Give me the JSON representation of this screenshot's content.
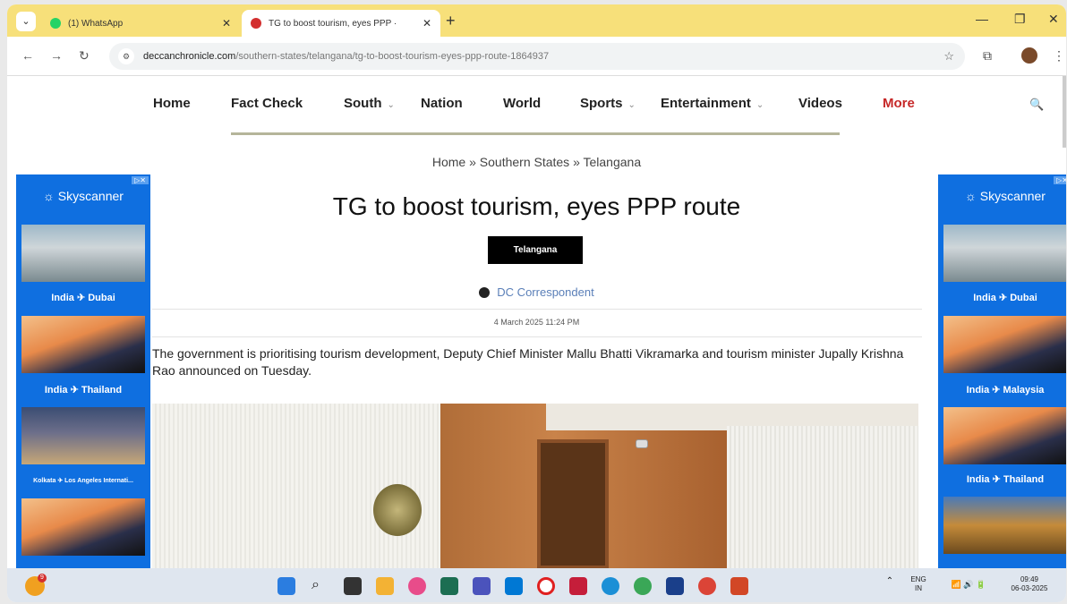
{
  "browser": {
    "tabs": [
      {
        "title": "(1) WhatsApp",
        "favicon_color": "#25d366"
      },
      {
        "title": "TG to boost tourism, eyes PPP · ",
        "favicon_color": "#d32f2f"
      }
    ],
    "url_domain": "deccanchronicle.com",
    "url_path": "/southern-states/telangana/tg-to-boost-tourism-eyes-ppp-route-1864937"
  },
  "site_nav": {
    "items": [
      "Home",
      "Fact Check",
      "South",
      "Nation",
      "World",
      "Sports",
      "Entertainment",
      "Videos",
      "More"
    ],
    "accent": "#c62828"
  },
  "article": {
    "breadcrumb": "Home » Southern States » Telangana",
    "headline": "TG to boost tourism, eyes PPP route",
    "category": "Telangana",
    "author": "DC Correspondent",
    "date": "4 March 2025 11:24 PM",
    "lead": "The government is prioritising tourism development, Deputy Chief Minister Mallu Bhatti Vikramarka and tourism minister Jupally Krishna Rao announced on Tuesday."
  },
  "ads": {
    "left": {
      "brand": "Skyscanner",
      "routes": [
        "India ✈ Dubai",
        "India ✈ Thailand",
        "Kolkata ✈ Los Angeles Internati..."
      ]
    },
    "right": {
      "brand": "Skyscanner",
      "routes": [
        "India ✈ Dubai",
        "India ✈ Malaysia",
        "India ✈ Thailand"
      ]
    },
    "color": "#0f6fe0"
  },
  "taskbar": {
    "weather_badge": "9",
    "lang": "ENG",
    "region": "IN",
    "time": "09:49",
    "date": "06-03-2025"
  }
}
